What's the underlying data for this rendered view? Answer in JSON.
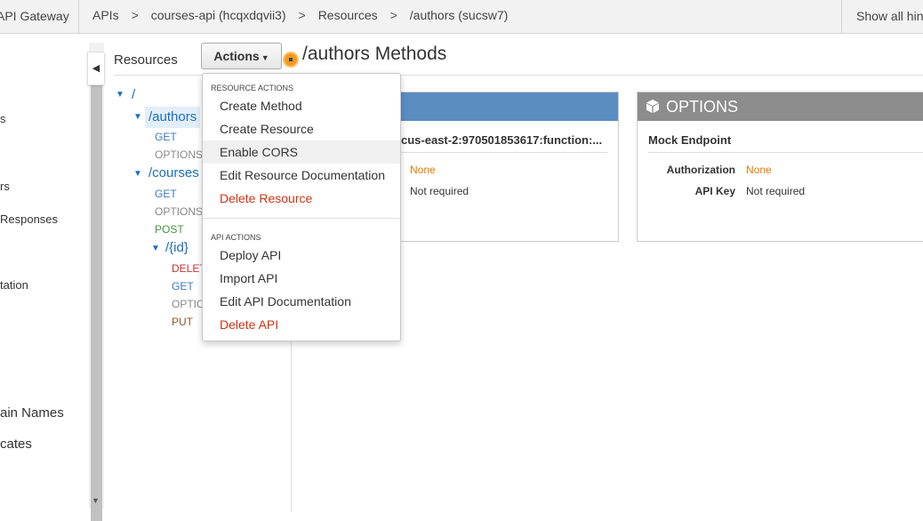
{
  "topbar": {
    "app_name": "API Gateway",
    "breadcrumbs": [
      "APIs",
      "courses-api (hcqxdqvii3)",
      "Resources",
      "/authors (sucsw7)"
    ],
    "separator": ">",
    "hints": "Show all hint"
  },
  "leftnav": {
    "items": [
      "s",
      "rs",
      "Responses",
      "tation",
      "ain Names",
      "cates"
    ]
  },
  "resources": {
    "title": "Resources",
    "actions_label": "Actions",
    "tree": {
      "root": "/",
      "authors": "/authors",
      "authors_methods": [
        "GET",
        "OPTIONS"
      ],
      "courses": "/courses",
      "courses_methods": [
        "GET",
        "OPTIONS",
        "POST"
      ],
      "id": "/{id}",
      "id_methods": [
        "DELETE",
        "GET",
        "OPTIONS",
        "PUT"
      ]
    }
  },
  "menu": {
    "resource_header": "RESOURCE ACTIONS",
    "resource_items": [
      "Create Method",
      "Create Resource",
      "Enable CORS",
      "Edit Resource Documentation",
      "Delete Resource"
    ],
    "api_header": "API ACTIONS",
    "api_items": [
      "Deploy API",
      "Import API",
      "Edit API Documentation",
      "Delete API"
    ]
  },
  "main": {
    "title": "/authors Methods",
    "card1": {
      "endpoint": "cus-east-2:970501853617:function:...",
      "authorization_value": "None",
      "api_key_value": "Not required"
    },
    "card2": {
      "title": "OPTIONS",
      "endpoint": "Mock Endpoint",
      "authorization_label": "Authorization",
      "authorization_value": "None",
      "api_key_label": "API Key",
      "api_key_value": "Not required"
    }
  },
  "colors": {
    "accent_blue": "#1c6fbf",
    "card_blue": "#5b8dc3",
    "card_gray": "#8c8c8c",
    "danger": "#d13212",
    "orange": "#e07b00"
  },
  "icons": {
    "cube": "cube-icon",
    "spinner": "loading-indicator-icon",
    "collapse": "chevron-left-icon",
    "caret": "caret-down-icon",
    "tree_toggle": "triangle-down-icon"
  }
}
